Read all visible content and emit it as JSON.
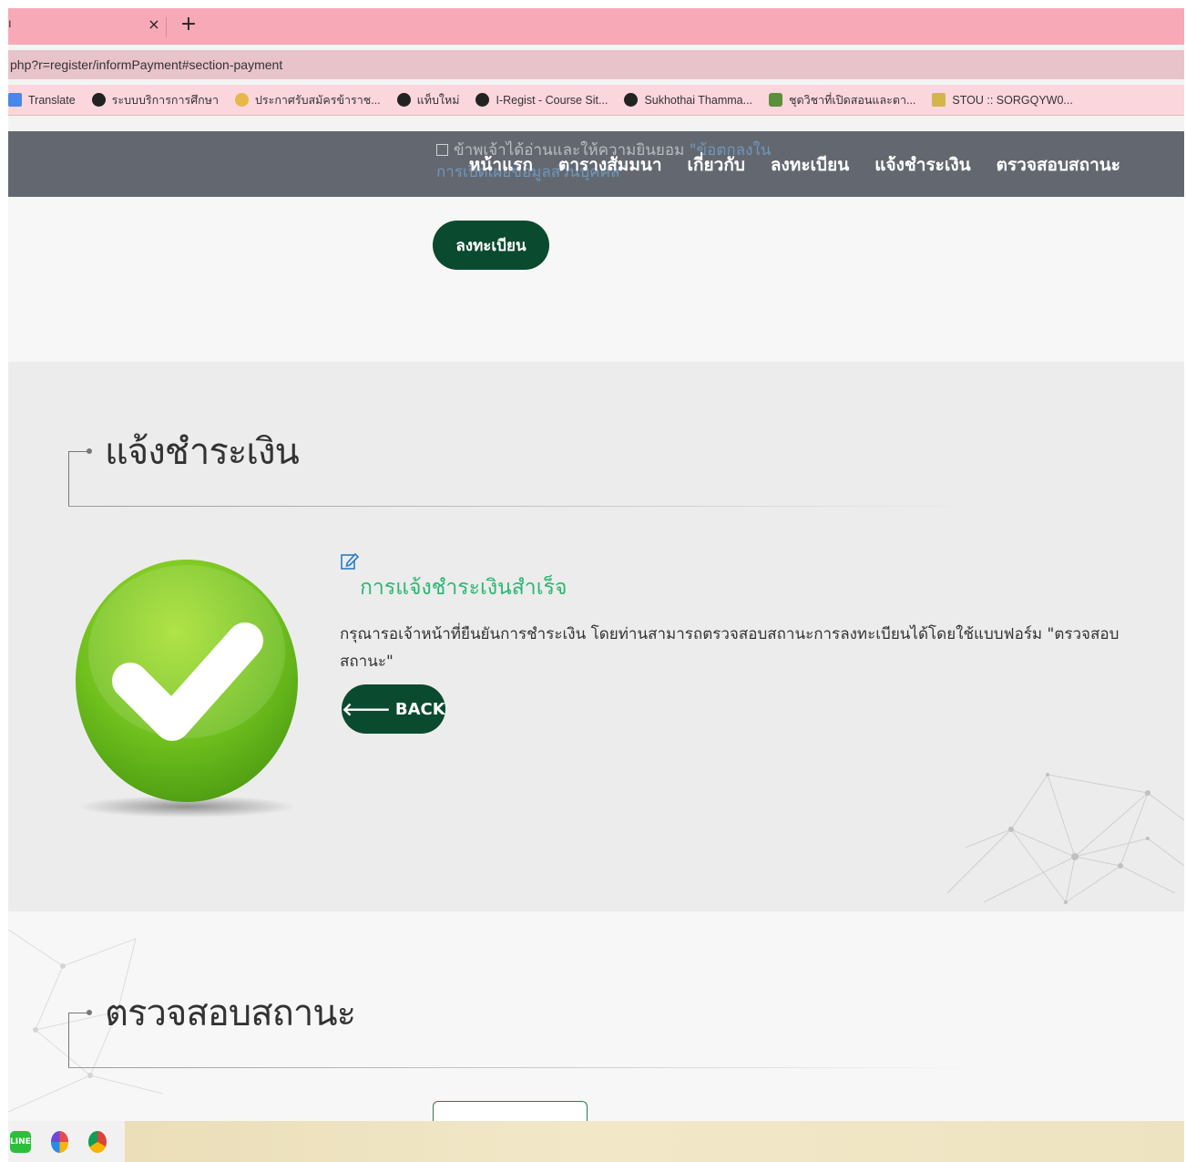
{
  "browser": {
    "tab_title": "ı",
    "tab_close": "×",
    "new_tab": "+",
    "url": "php?r=register/informPayment#section-payment",
    "bookmarks": [
      {
        "label": "Translate",
        "icon": "translate-icon"
      },
      {
        "label": "ระบบบริการการศึกษา",
        "icon": "globe-icon"
      },
      {
        "label": "ประกาศรับสมัครข้าราช...",
        "icon": "crown-icon"
      },
      {
        "label": "แท็บใหม่",
        "icon": "globe-icon"
      },
      {
        "label": "I-Regist - Course Sit...",
        "icon": "globe-icon"
      },
      {
        "label": "Sukhothai Thamma...",
        "icon": "globe-icon"
      },
      {
        "label": "ชุดวิชาที่เปิดสอนและตา...",
        "icon": "leaf-icon"
      },
      {
        "label": "STOU :: SORGQYW0...",
        "icon": "pagoda-icon"
      }
    ]
  },
  "nav": {
    "items": [
      "หน้าแรก",
      "ตารางสัมมนา",
      "เกี่ยวกับ",
      "ลงทะเบียน",
      "แจ้งชำระเงิน",
      "ตรวจสอบสถานะ"
    ],
    "consent_text": "ข้าพเจ้าได้อ่านและให้ความยินยอม ",
    "consent_link": "\"ข้อตกลงใน",
    "consent_line2": "การเปิดเผยข้อมูลส่วนบุคคล\""
  },
  "register_button": "ลงทะเบียน",
  "payment": {
    "section_title": "แจ้งชำระเงิน",
    "success_title": "การแจ้งชำระเงินสำเร็จ",
    "description": "กรุณารอเจ้าหน้าที่ยืนยันการชำระเงิน โดยท่านสามารถตรวจสอบสถานะการลงทะเบียนได้โดยใช้แบบฟอร์ม \"ตรวจสอบสถานะ\"",
    "back_label": "BACK",
    "back_icon": "arrow-left-icon",
    "edit_icon": "edit-icon",
    "check_icon": "checkmark-circle-icon"
  },
  "status": {
    "section_title": "ตรวจสอบสถานะ"
  },
  "taskbar": {
    "icons": [
      {
        "name": "line-app-icon",
        "label": "LINE"
      },
      {
        "name": "office-icon",
        "label": ""
      },
      {
        "name": "chrome-icon",
        "label": ""
      }
    ]
  },
  "colors": {
    "navbar": "#636870",
    "button": "#0a4a2f",
    "success": "#2bb673",
    "tab_strip": "#f7a9b8"
  }
}
